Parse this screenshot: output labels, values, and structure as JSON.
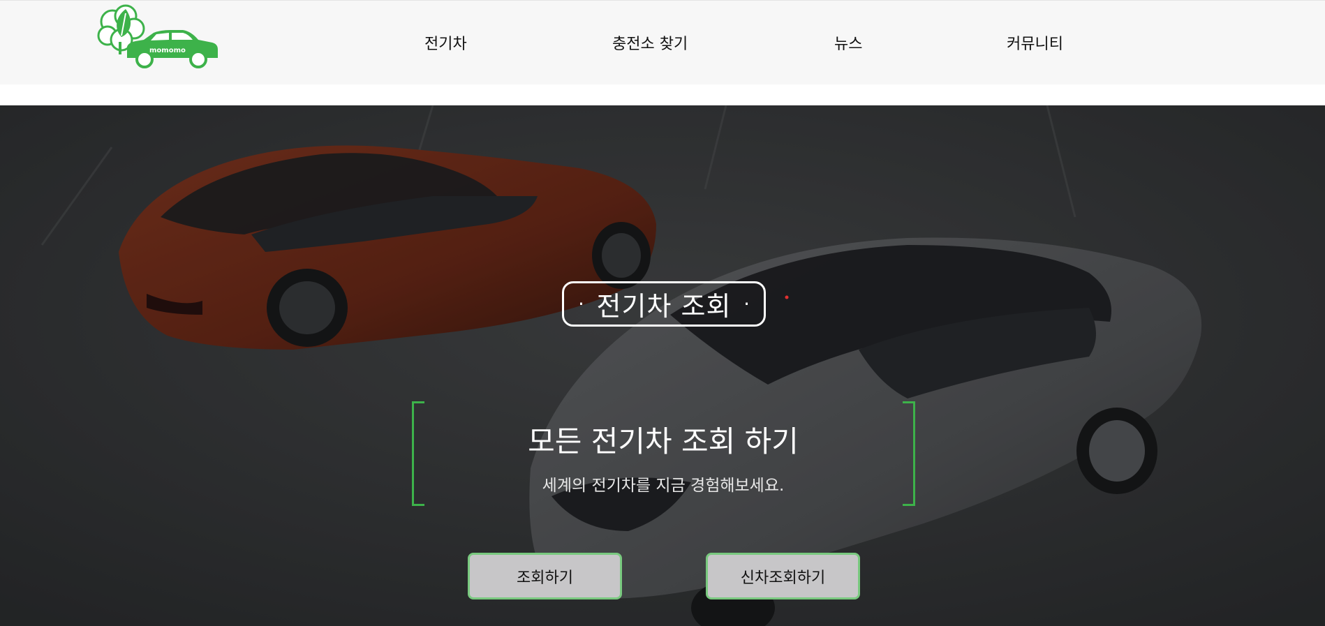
{
  "header": {
    "logo_text": "momomo",
    "nav": [
      {
        "label": "전기차"
      },
      {
        "label": "충전소 찾기"
      },
      {
        "label": "뉴스"
      },
      {
        "label": "커뮤니티"
      }
    ]
  },
  "hero": {
    "badge_title": "전기차 조회",
    "badge_dot": "·",
    "headline": "모든 전기차 조회 하기",
    "subtext": "세계의 전기차를 지금 경험해보세요.",
    "buttons": [
      {
        "label": "조회하기"
      },
      {
        "label": "신차조회하기"
      }
    ]
  },
  "colors": {
    "brand_green": "#3db24a",
    "header_bg": "#f7f7f7",
    "button_bg": "#c7c6c8",
    "button_border": "#79c97f"
  }
}
